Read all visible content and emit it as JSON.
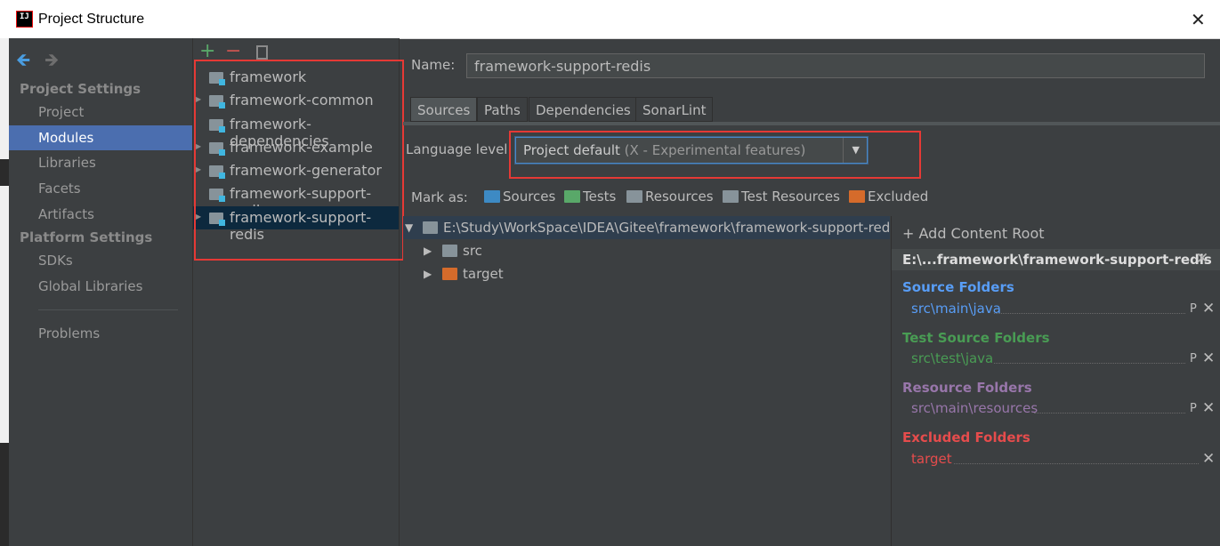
{
  "window": {
    "title": "Project Structure"
  },
  "nav": {
    "project_settings": "Project Settings",
    "project_items": [
      "Project",
      "Modules",
      "Libraries",
      "Facets",
      "Artifacts"
    ],
    "platform_settings": "Platform Settings",
    "platform_items": [
      "SDKs",
      "Global Libraries"
    ],
    "problems": "Problems",
    "selected": "Modules"
  },
  "toolbar": {
    "add": "+",
    "remove": "−"
  },
  "modules": [
    {
      "label": "framework"
    },
    {
      "label": "framework-common"
    },
    {
      "label": "framework-dependencies"
    },
    {
      "label": "framework-example"
    },
    {
      "label": "framework-generator"
    },
    {
      "label": "framework-support-mail"
    },
    {
      "label": "framework-support-redis"
    }
  ],
  "name_label": "Name:",
  "name_value": "framework-support-redis",
  "tabs": [
    "Sources",
    "Paths",
    "Dependencies",
    "SonarLint"
  ],
  "language_level": {
    "label": "Language level:",
    "value": "Project default",
    "value_note": "(X - Experimental features)"
  },
  "mark_as": {
    "label": "Mark as:",
    "buttons": [
      {
        "label": "Sources",
        "color": "#3d8ac4"
      },
      {
        "label": "Tests",
        "color": "#59a869"
      },
      {
        "label": "Resources",
        "color": "#87939a"
      },
      {
        "label": "Test Resources",
        "color": "#87939a"
      },
      {
        "label": "Excluded",
        "color": "#d56b2b"
      }
    ]
  },
  "tree": {
    "root": "E:\\Study\\WorkSpace\\IDEA\\Gitee\\framework\\framework-support-redi",
    "children": [
      "src",
      "target"
    ]
  },
  "content_root": {
    "add_label": "+ Add Content Root",
    "header": "E:\\...framework\\framework-support-redis",
    "sections": [
      {
        "title": "Source Folders",
        "path": "src\\main\\java",
        "color": "#589df6"
      },
      {
        "title": "Test Source Folders",
        "path": "src\\test\\java",
        "color": "#499c54"
      },
      {
        "title": "Resource Folders",
        "path": "src\\main\\resources",
        "color": "#9876aa"
      },
      {
        "title": "Excluded Folders",
        "path": "target",
        "color": "#e64c4c"
      }
    ],
    "props_label": "P",
    "close_label": "✕"
  }
}
